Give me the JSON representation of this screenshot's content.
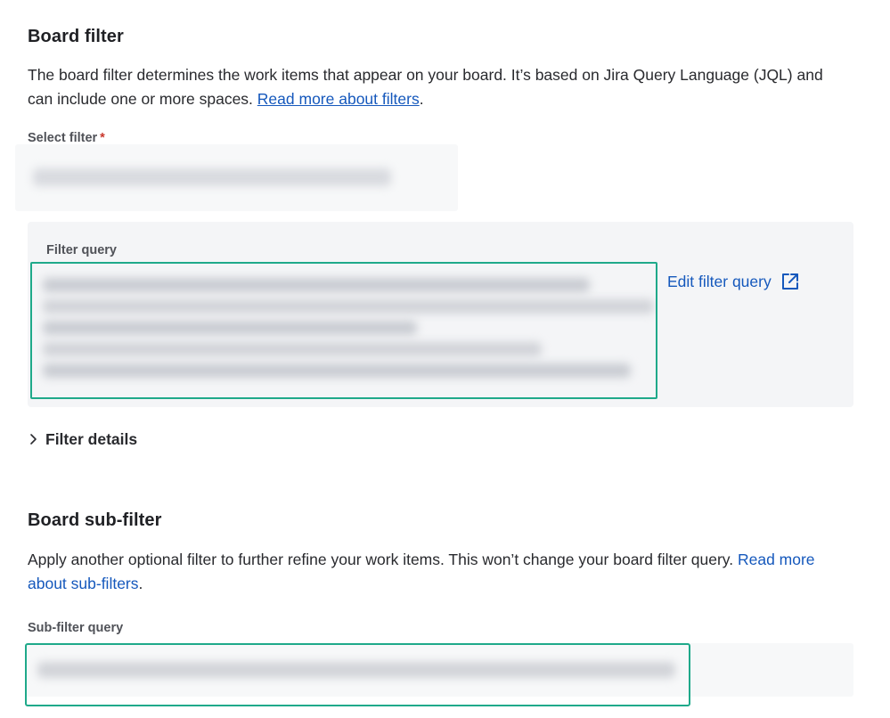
{
  "board_filter": {
    "title": "Board filter",
    "description_text": "The board filter determines the work items that appear on your board. It’s based on Jira Query Language (JQL) and can include one or more spaces. ",
    "read_more_link": "Read more about filters",
    "description_end": ".",
    "select_label": "Select filter",
    "required_marker": "*",
    "query_label": "Filter query",
    "edit_link": "Edit filter query",
    "edit_icon": "external-link-icon",
    "details_toggle": "Filter details",
    "details_icon": "chevron-right-icon"
  },
  "board_subfilter": {
    "title": "Board sub-filter",
    "description_text": "Apply another optional filter to further refine your work items. This won’t change your board filter query. ",
    "read_more_link": "Read more about sub-filters",
    "description_end": ".",
    "query_label": "Sub-filter query"
  },
  "colors": {
    "link": "#1558bc",
    "highlight_border": "#1fa98a",
    "required": "#c9372c",
    "panel_bg": "#f4f5f7"
  }
}
